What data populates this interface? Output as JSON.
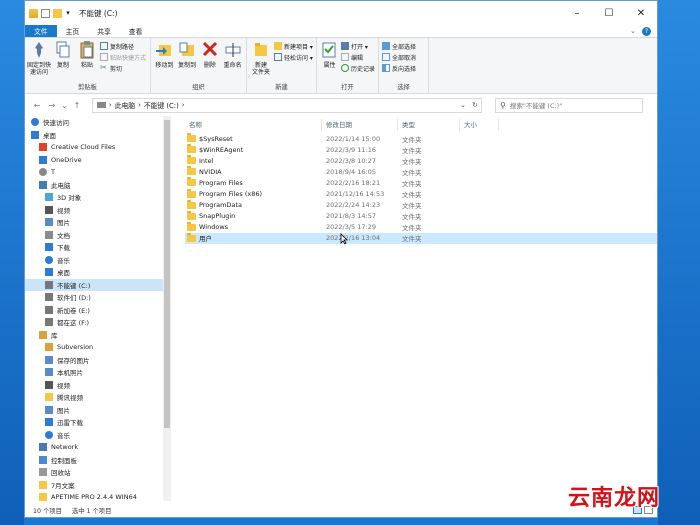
{
  "window": {
    "title": "不能键 (C:)"
  },
  "tabs": [
    {
      "label": "文件"
    },
    {
      "label": "主页"
    },
    {
      "label": "共享"
    },
    {
      "label": "查看"
    }
  ],
  "ribbon": {
    "clipboard": {
      "pin": "固定到快\n速访问",
      "copy": "复制",
      "paste": "粘贴",
      "copy_path": "复制路径",
      "paste_shortcut": "粘贴快捷方式",
      "cut": "剪切",
      "group": "剪贴板"
    },
    "organize": {
      "move": "移动到",
      "copyto": "复制到",
      "delete": "删除",
      "rename": "重命名",
      "group": "组织"
    },
    "new": {
      "new_folder": "新建\n文件夹",
      "new_item": "新建项目 ▾",
      "easy_access": "轻松访问 ▾",
      "group": "新建"
    },
    "open": {
      "properties": "属性",
      "open": "打开 ▾",
      "edit": "编辑",
      "history": "历史记录",
      "group": "打开"
    },
    "select": {
      "select_all": "全部选择",
      "select_none": "全部取消",
      "invert": "反向选择",
      "group": "选择"
    }
  },
  "address": {
    "path": [
      "此电脑",
      "不能键 (C:)"
    ],
    "search_placeholder": "搜索\"不能键 (C:)\""
  },
  "nav_items": [
    {
      "label": "快速访问",
      "icon": "star-icon",
      "indent": 6
    },
    {
      "label": "桌面",
      "icon": "desktop-icon",
      "indent": 6
    },
    {
      "label": "Creative Cloud Files",
      "icon": "cloud-icon",
      "indent": 14
    },
    {
      "label": "OneDrive",
      "icon": "onedrive-icon",
      "indent": 14
    },
    {
      "label": "T",
      "icon": "user-icon",
      "indent": 14
    },
    {
      "label": "此电脑",
      "icon": "computer-icon",
      "indent": 14
    },
    {
      "label": "3D 对象",
      "icon": "cube-icon",
      "indent": 20
    },
    {
      "label": "视频",
      "icon": "video-icon",
      "indent": 20
    },
    {
      "label": "图片",
      "icon": "picture-icon",
      "indent": 20
    },
    {
      "label": "文档",
      "icon": "document-icon",
      "indent": 20
    },
    {
      "label": "下载",
      "icon": "download-icon",
      "indent": 20
    },
    {
      "label": "音乐",
      "icon": "music-icon",
      "indent": 20
    },
    {
      "label": "桌面",
      "icon": "desktop-icon",
      "indent": 20
    },
    {
      "label": "不能键 (C:)",
      "icon": "drive-icon",
      "indent": 20,
      "selected": true
    },
    {
      "label": "软件们 (D:)",
      "icon": "drive-icon",
      "indent": 20
    },
    {
      "label": "新加卷 (E:)",
      "icon": "drive-icon",
      "indent": 20
    },
    {
      "label": "都在这 (F:)",
      "icon": "drive-icon",
      "indent": 20
    },
    {
      "label": "库",
      "icon": "library-icon",
      "indent": 14
    },
    {
      "label": "Subversion",
      "icon": "library-icon",
      "indent": 20
    },
    {
      "label": "保存的图片",
      "icon": "picture-icon",
      "indent": 20
    },
    {
      "label": "本机照片",
      "icon": "picture-icon",
      "indent": 20
    },
    {
      "label": "视频",
      "icon": "video-icon",
      "indent": 20
    },
    {
      "label": "腾讯视频",
      "icon": "folder-icon",
      "indent": 20
    },
    {
      "label": "图片",
      "icon": "picture-icon",
      "indent": 20
    },
    {
      "label": "迅雷下载",
      "icon": "download-icon",
      "indent": 20
    },
    {
      "label": "音乐",
      "icon": "music-icon",
      "indent": 20
    },
    {
      "label": "Network",
      "icon": "network-icon",
      "indent": 14
    },
    {
      "label": "控制面板",
      "icon": "control-panel-icon",
      "indent": 14
    },
    {
      "label": "回收站",
      "icon": "recycle-bin-icon",
      "indent": 14
    },
    {
      "label": "7月文案",
      "icon": "folder-icon",
      "indent": 14
    },
    {
      "label": "APETIME PRO 2.4.4 WIN64",
      "icon": "folder-icon",
      "indent": 14
    }
  ],
  "columns": {
    "name": "名称",
    "date": "修改日期",
    "type": "类型",
    "size": "大小"
  },
  "files": [
    {
      "name": "$SysReset",
      "date": "2022/1/14 15:00",
      "type": "文件夹"
    },
    {
      "name": "$WinREAgent",
      "date": "2022/3/9 11:16",
      "type": "文件夹"
    },
    {
      "name": "Intel",
      "date": "2022/3/8 10:27",
      "type": "文件夹"
    },
    {
      "name": "NVIDIA",
      "date": "2018/9/4 16:05",
      "type": "文件夹"
    },
    {
      "name": "Program Files",
      "date": "2022/2/16 18:21",
      "type": "文件夹"
    },
    {
      "name": "Program Files (x86)",
      "date": "2021/12/16 14:53",
      "type": "文件夹"
    },
    {
      "name": "ProgramData",
      "date": "2022/2/24 14:23",
      "type": "文件夹"
    },
    {
      "name": "SnapPlugin",
      "date": "2021/8/3 14:57",
      "type": "文件夹"
    },
    {
      "name": "Windows",
      "date": "2022/3/5 17:29",
      "type": "文件夹"
    },
    {
      "name": "用户",
      "date": "2022/2/16 13:04",
      "type": "文件夹",
      "hover": true
    }
  ],
  "status": {
    "count": "10 个项目",
    "selected": "选中 1 个项目"
  },
  "watermark": "云南龙网"
}
